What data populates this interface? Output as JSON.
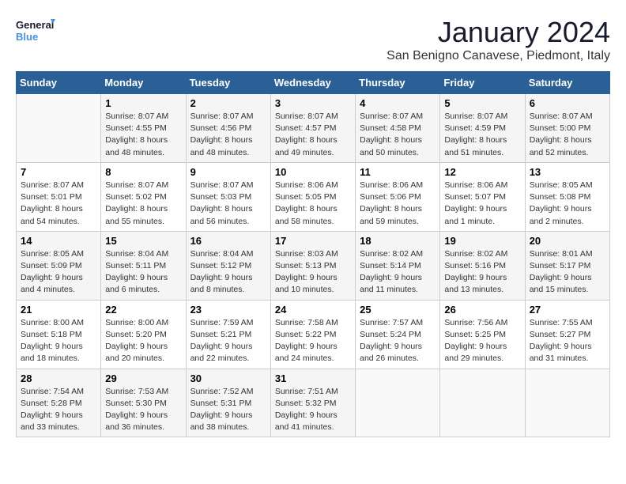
{
  "header": {
    "logo_general": "General",
    "logo_blue": "Blue",
    "month": "January 2024",
    "location": "San Benigno Canavese, Piedmont, Italy"
  },
  "days_of_week": [
    "Sunday",
    "Monday",
    "Tuesday",
    "Wednesday",
    "Thursday",
    "Friday",
    "Saturday"
  ],
  "weeks": [
    [
      {
        "day": "",
        "info": ""
      },
      {
        "day": "1",
        "info": "Sunrise: 8:07 AM\nSunset: 4:55 PM\nDaylight: 8 hours\nand 48 minutes."
      },
      {
        "day": "2",
        "info": "Sunrise: 8:07 AM\nSunset: 4:56 PM\nDaylight: 8 hours\nand 48 minutes."
      },
      {
        "day": "3",
        "info": "Sunrise: 8:07 AM\nSunset: 4:57 PM\nDaylight: 8 hours\nand 49 minutes."
      },
      {
        "day": "4",
        "info": "Sunrise: 8:07 AM\nSunset: 4:58 PM\nDaylight: 8 hours\nand 50 minutes."
      },
      {
        "day": "5",
        "info": "Sunrise: 8:07 AM\nSunset: 4:59 PM\nDaylight: 8 hours\nand 51 minutes."
      },
      {
        "day": "6",
        "info": "Sunrise: 8:07 AM\nSunset: 5:00 PM\nDaylight: 8 hours\nand 52 minutes."
      }
    ],
    [
      {
        "day": "7",
        "info": "Sunrise: 8:07 AM\nSunset: 5:01 PM\nDaylight: 8 hours\nand 54 minutes."
      },
      {
        "day": "8",
        "info": "Sunrise: 8:07 AM\nSunset: 5:02 PM\nDaylight: 8 hours\nand 55 minutes."
      },
      {
        "day": "9",
        "info": "Sunrise: 8:07 AM\nSunset: 5:03 PM\nDaylight: 8 hours\nand 56 minutes."
      },
      {
        "day": "10",
        "info": "Sunrise: 8:06 AM\nSunset: 5:05 PM\nDaylight: 8 hours\nand 58 minutes."
      },
      {
        "day": "11",
        "info": "Sunrise: 8:06 AM\nSunset: 5:06 PM\nDaylight: 8 hours\nand 59 minutes."
      },
      {
        "day": "12",
        "info": "Sunrise: 8:06 AM\nSunset: 5:07 PM\nDaylight: 9 hours\nand 1 minute."
      },
      {
        "day": "13",
        "info": "Sunrise: 8:05 AM\nSunset: 5:08 PM\nDaylight: 9 hours\nand 2 minutes."
      }
    ],
    [
      {
        "day": "14",
        "info": "Sunrise: 8:05 AM\nSunset: 5:09 PM\nDaylight: 9 hours\nand 4 minutes."
      },
      {
        "day": "15",
        "info": "Sunrise: 8:04 AM\nSunset: 5:11 PM\nDaylight: 9 hours\nand 6 minutes."
      },
      {
        "day": "16",
        "info": "Sunrise: 8:04 AM\nSunset: 5:12 PM\nDaylight: 9 hours\nand 8 minutes."
      },
      {
        "day": "17",
        "info": "Sunrise: 8:03 AM\nSunset: 5:13 PM\nDaylight: 9 hours\nand 10 minutes."
      },
      {
        "day": "18",
        "info": "Sunrise: 8:02 AM\nSunset: 5:14 PM\nDaylight: 9 hours\nand 11 minutes."
      },
      {
        "day": "19",
        "info": "Sunrise: 8:02 AM\nSunset: 5:16 PM\nDaylight: 9 hours\nand 13 minutes."
      },
      {
        "day": "20",
        "info": "Sunrise: 8:01 AM\nSunset: 5:17 PM\nDaylight: 9 hours\nand 15 minutes."
      }
    ],
    [
      {
        "day": "21",
        "info": "Sunrise: 8:00 AM\nSunset: 5:18 PM\nDaylight: 9 hours\nand 18 minutes."
      },
      {
        "day": "22",
        "info": "Sunrise: 8:00 AM\nSunset: 5:20 PM\nDaylight: 9 hours\nand 20 minutes."
      },
      {
        "day": "23",
        "info": "Sunrise: 7:59 AM\nSunset: 5:21 PM\nDaylight: 9 hours\nand 22 minutes."
      },
      {
        "day": "24",
        "info": "Sunrise: 7:58 AM\nSunset: 5:22 PM\nDaylight: 9 hours\nand 24 minutes."
      },
      {
        "day": "25",
        "info": "Sunrise: 7:57 AM\nSunset: 5:24 PM\nDaylight: 9 hours\nand 26 minutes."
      },
      {
        "day": "26",
        "info": "Sunrise: 7:56 AM\nSunset: 5:25 PM\nDaylight: 9 hours\nand 29 minutes."
      },
      {
        "day": "27",
        "info": "Sunrise: 7:55 AM\nSunset: 5:27 PM\nDaylight: 9 hours\nand 31 minutes."
      }
    ],
    [
      {
        "day": "28",
        "info": "Sunrise: 7:54 AM\nSunset: 5:28 PM\nDaylight: 9 hours\nand 33 minutes."
      },
      {
        "day": "29",
        "info": "Sunrise: 7:53 AM\nSunset: 5:30 PM\nDaylight: 9 hours\nand 36 minutes."
      },
      {
        "day": "30",
        "info": "Sunrise: 7:52 AM\nSunset: 5:31 PM\nDaylight: 9 hours\nand 38 minutes."
      },
      {
        "day": "31",
        "info": "Sunrise: 7:51 AM\nSunset: 5:32 PM\nDaylight: 9 hours\nand 41 minutes."
      },
      {
        "day": "",
        "info": ""
      },
      {
        "day": "",
        "info": ""
      },
      {
        "day": "",
        "info": ""
      }
    ]
  ]
}
